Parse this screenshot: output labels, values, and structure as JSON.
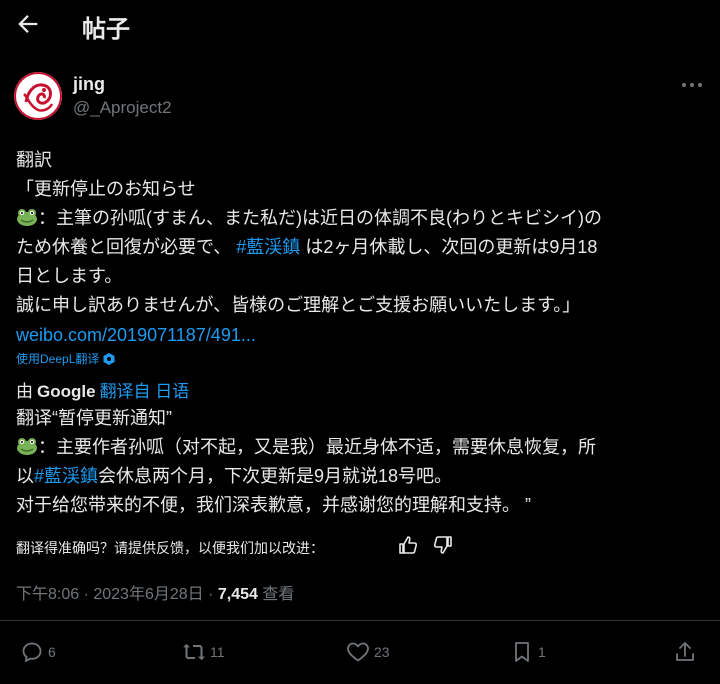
{
  "header": {
    "title": "帖子"
  },
  "author": {
    "name": "jing",
    "handle": "@_Aproject2"
  },
  "post": {
    "label": "翻訳",
    "line1": "「更新停止のお知らせ",
    "line2_pre": "：主筆の孙呱(すまん、また私だ)は近日の体調不良(わりとキビシイ)の",
    "line3_pre": "ため休養と回復が必要で、",
    "line3_tag": "#藍渓鎮",
    "line3_post": "は2ヶ月休載し、次回の更新は9月18",
    "line4": "日とします。",
    "line5": "誠に申し訳ありませんが、皆様のご理解とご支援お願いいたします。」",
    "link": "weibo.com/2019071187/491..."
  },
  "deepl_note": "使用DeepL翻译",
  "translation_bar": {
    "by": "由",
    "google": "Google",
    "from": "翻译自 日语"
  },
  "translation": {
    "line1": "翻译“暂停更新通知”",
    "line2": "：主要作者孙呱（对不起，又是我）最近身体不适，需要休息恢复，所",
    "line3_pre": "以",
    "line3_tag": "#藍渓鎮",
    "line3_post": "会休息两个月，下次更新是9月就说18号吧。",
    "line4": "对于给您带来的不便，我们深表歉意，并感谢您的理解和支持。 ”"
  },
  "feedback": {
    "question": "翻译得准确吗？请提供反馈，以便我们加以改进："
  },
  "meta": {
    "time": "下午8:06 · 2023年6月28日 · ",
    "views": "7,454",
    "views_label": " 查看"
  },
  "actions": {
    "replies": "6",
    "reposts": "11",
    "likes": "23",
    "bookmarks": "1"
  },
  "colors": {
    "accent": "#1d9bf0",
    "muted": "#71767b",
    "background": "#000000"
  }
}
